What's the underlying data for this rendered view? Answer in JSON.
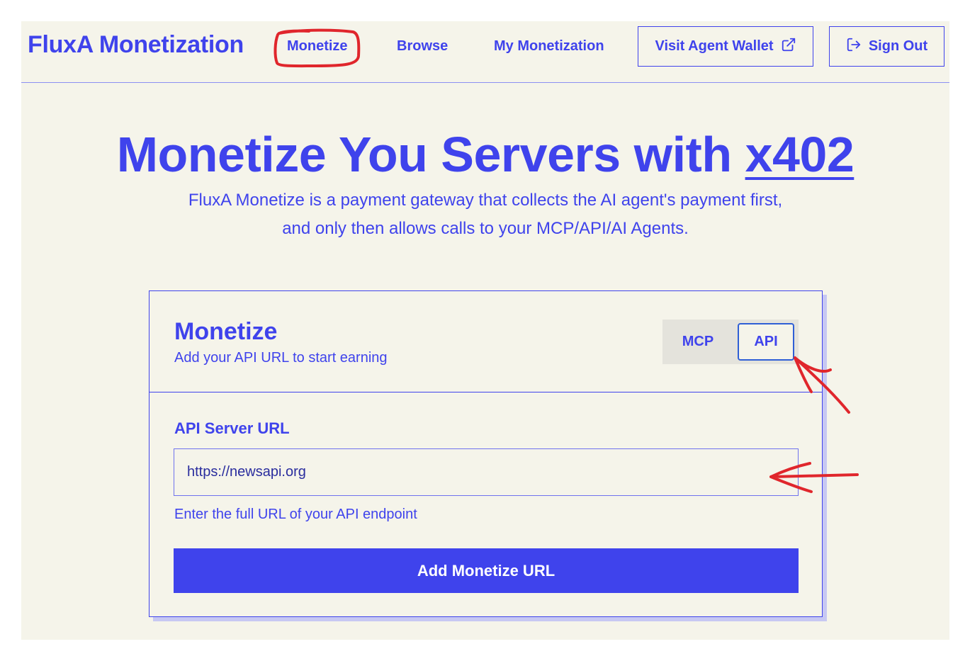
{
  "header": {
    "brand": "FluxA Monetization",
    "nav": {
      "monetize": "Monetize",
      "browse": "Browse",
      "my_monetization": "My Monetization"
    },
    "visit_wallet_label": "Visit Agent Wallet",
    "sign_out_label": "Sign Out"
  },
  "hero": {
    "title_prefix": "Monetize You Servers with ",
    "title_link": "x402",
    "subtitle_line1": "FluxA Monetize is a payment gateway that collects the AI agent's payment first,",
    "subtitle_line2": "and only then allows calls to your MCP/API/AI Agents."
  },
  "card": {
    "title": "Monetize",
    "subtitle": "Add your API URL to start earning",
    "toggle": {
      "options": [
        "MCP",
        "API"
      ],
      "selected": "API"
    },
    "field_label": "API Server URL",
    "url_value": "https://newsapi.org",
    "helper_text": "Enter the full URL of your API endpoint",
    "submit_label": "Add Monetize URL"
  },
  "colors": {
    "accent": "#3f43ec",
    "background": "#f5f4ea",
    "annotation": "#e0262c"
  },
  "icons": {
    "visit_wallet": "external-link-icon",
    "sign_out": "sign-out-icon"
  }
}
